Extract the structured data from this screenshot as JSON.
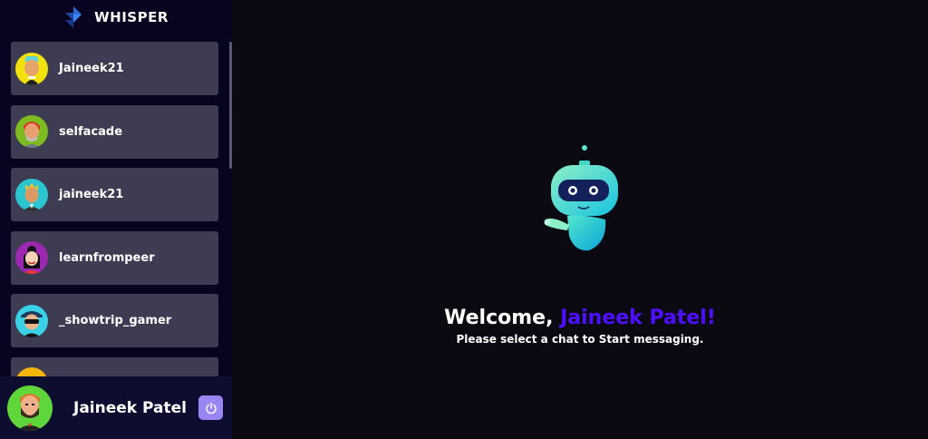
{
  "brand": {
    "title": "WHISPER",
    "logo_icon": "whisper-logo-icon"
  },
  "contacts": [
    {
      "name": "Jaineek21",
      "avatar": "avatar-yellow-punk"
    },
    {
      "name": "selfacade",
      "avatar": "avatar-green-redhead"
    },
    {
      "name": "jaineek21",
      "avatar": "avatar-teal-crown"
    },
    {
      "name": "learnfrompeer",
      "avatar": "avatar-purple-girl"
    },
    {
      "name": "_showtrip_gamer",
      "avatar": "avatar-cyan-sunglasses"
    },
    {
      "name": "",
      "avatar": "avatar-orange"
    }
  ],
  "current_user": {
    "name": "Jaineek Patel",
    "avatar": "avatar-green-bearded"
  },
  "logout": {
    "icon": "power-icon"
  },
  "welcome": {
    "greeting": "Welcome, ",
    "username": "Jaineek Patel!",
    "subtitle": "Please select a chat to Start messaging."
  },
  "colors": {
    "sidebar_bg": "#080420",
    "contact_bg": "#3e3c52",
    "accent": "#4e0eff",
    "logout_bg": "#9a86f3",
    "main_bg": "#0b0a13"
  }
}
